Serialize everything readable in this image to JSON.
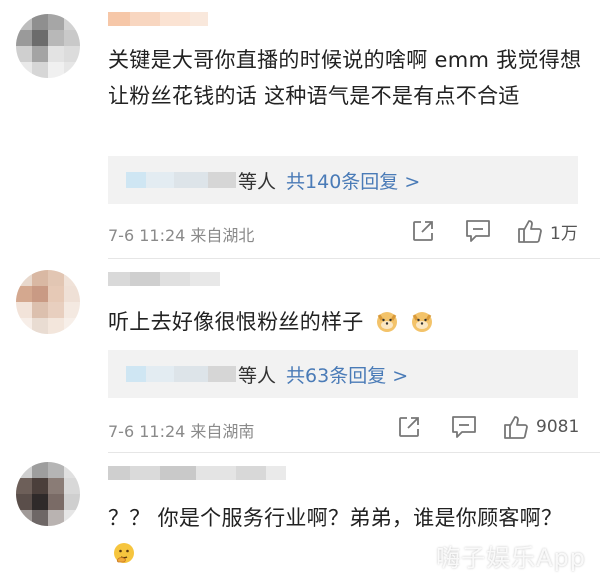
{
  "comments": [
    {
      "text": "关键是大哥你直播的时候说的啥啊 emm 我觉得想让粉丝花钱的话 这种语气是不是有点不合适",
      "reply_suffix": "等人",
      "reply_link": "共140条回复 >",
      "meta": "7-6 11:24  来自湖北",
      "likes": "1万"
    },
    {
      "text": "听上去好像很恨粉丝的样子",
      "reply_suffix": "等人",
      "reply_link": "共63条回复 >",
      "meta": "7-6 11:24  来自湖南",
      "likes": "9081"
    },
    {
      "text": "？？ 你是个服务行业啊？弟弟，谁是你顾客啊？"
    }
  ],
  "icons": {
    "share": "share-icon",
    "comment": "comment-icon",
    "like": "thumbs-up-icon",
    "dog_emoji": "doge-emoji-icon",
    "think_emoji": "thinking-emoji-icon"
  },
  "colors": {
    "link": "#4a7bb7",
    "meta": "#8a8a8a",
    "reply_bg": "#f2f2f2"
  },
  "watermark": "嗨子娱乐App"
}
